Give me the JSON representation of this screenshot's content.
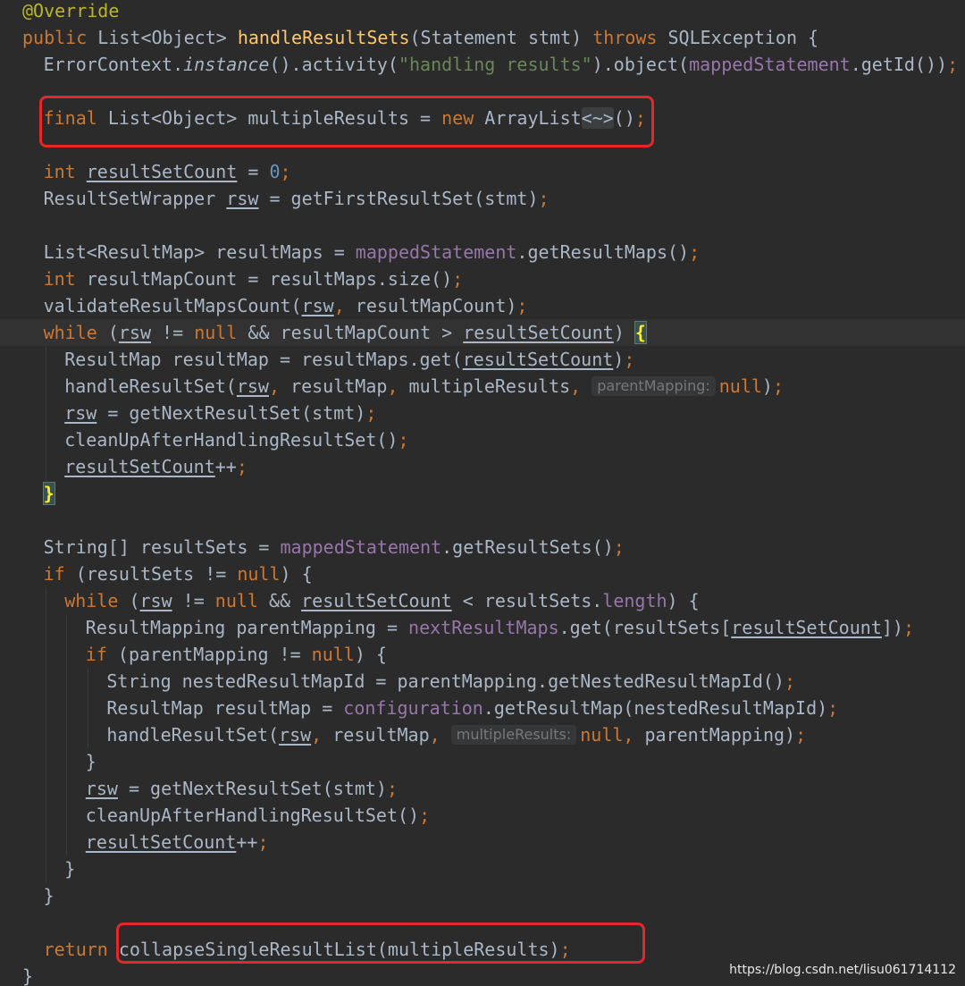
{
  "watermark": "https://blog.csdn.net/lisu061714112",
  "highlight_color": "#e5262b",
  "theme": {
    "background": "#2b2b2b",
    "keyword": "#cc7832",
    "annotation": "#bbb529",
    "method_declaration": "#ffc66d",
    "string": "#6a8759",
    "number": "#6897bb",
    "field": "#9876aa",
    "plain": "#a9b7c6"
  },
  "code": {
    "lines": [
      {
        "indent": 0,
        "tokens": [
          {
            "t": "@Override",
            "c": "ann"
          }
        ]
      },
      {
        "indent": 0,
        "tokens": [
          {
            "t": "public ",
            "c": "kw"
          },
          {
            "t": "List<Object> "
          },
          {
            "t": "handleResultSets",
            "c": "fn"
          },
          {
            "t": "(Statement stmt) "
          },
          {
            "t": "throws ",
            "c": "kw"
          },
          {
            "t": "SQLException {"
          }
        ]
      },
      {
        "indent": 1,
        "tokens": [
          {
            "t": "ErrorContext."
          },
          {
            "t": "instance",
            "c": "it"
          },
          {
            "t": "().activity("
          },
          {
            "t": "\"handling results\"",
            "c": "str"
          },
          {
            "t": ").object("
          },
          {
            "t": "mappedStatement",
            "c": "fld"
          },
          {
            "t": ".getId())"
          },
          {
            "t": ";",
            "c": "kw"
          }
        ]
      },
      {
        "indent": 0,
        "tokens": []
      },
      {
        "indent": 1,
        "tokens": [
          {
            "t": "final ",
            "c": "kw"
          },
          {
            "t": "List<Object> multipleResults = "
          },
          {
            "t": "new ",
            "c": "kw"
          },
          {
            "t": "ArrayList"
          },
          {
            "t": "<~>",
            "c": "fold"
          },
          {
            "t": "()"
          },
          {
            "t": ";",
            "c": "kw"
          }
        ]
      },
      {
        "indent": 0,
        "tokens": []
      },
      {
        "indent": 1,
        "tokens": [
          {
            "t": "int ",
            "c": "kw"
          },
          {
            "t": "resultSetCount",
            "c": "ul"
          },
          {
            "t": " = "
          },
          {
            "t": "0",
            "c": "num"
          },
          {
            "t": ";",
            "c": "kw"
          }
        ]
      },
      {
        "indent": 1,
        "tokens": [
          {
            "t": "ResultSetWrapper "
          },
          {
            "t": "rsw",
            "c": "ul"
          },
          {
            "t": " = getFirstResultSet(stmt)"
          },
          {
            "t": ";",
            "c": "kw"
          }
        ]
      },
      {
        "indent": 0,
        "tokens": []
      },
      {
        "indent": 1,
        "tokens": [
          {
            "t": "List<ResultMap> resultMaps = "
          },
          {
            "t": "mappedStatement",
            "c": "fld"
          },
          {
            "t": ".getResultMaps()"
          },
          {
            "t": ";",
            "c": "kw"
          }
        ]
      },
      {
        "indent": 1,
        "tokens": [
          {
            "t": "int ",
            "c": "kw"
          },
          {
            "t": "resultMapCount = resultMaps.size()"
          },
          {
            "t": ";",
            "c": "kw"
          }
        ]
      },
      {
        "indent": 1,
        "tokens": [
          {
            "t": "validateResultMapsCount("
          },
          {
            "t": "rsw",
            "c": "ul"
          },
          {
            "t": ", ",
            "c": "kw"
          },
          {
            "t": "resultMapCount)"
          },
          {
            "t": ";",
            "c": "kw"
          }
        ]
      },
      {
        "indent": 1,
        "current": true,
        "tokens": [
          {
            "t": "while ",
            "c": "kw"
          },
          {
            "t": "("
          },
          {
            "t": "rsw",
            "c": "ul"
          },
          {
            "t": " != "
          },
          {
            "t": "null ",
            "c": "kw"
          },
          {
            "t": "&& resultMapCount > "
          },
          {
            "t": "resultSetCount",
            "c": "ul"
          },
          {
            "t": ") "
          },
          {
            "t": "{",
            "c": "bracehl"
          }
        ]
      },
      {
        "indent": 2,
        "tokens": [
          {
            "t": "ResultMap resultMap = resultMaps.get("
          },
          {
            "t": "resultSetCount",
            "c": "ul"
          },
          {
            "t": ")"
          },
          {
            "t": ";",
            "c": "kw"
          }
        ]
      },
      {
        "indent": 2,
        "tokens": [
          {
            "t": "handleResultSet("
          },
          {
            "t": "rsw",
            "c": "ul"
          },
          {
            "t": ", ",
            "c": "kw"
          },
          {
            "t": "resultMap"
          },
          {
            "t": ", ",
            "c": "kw"
          },
          {
            "t": "multipleResults"
          },
          {
            "t": ", ",
            "c": "kw"
          },
          {
            "t": "parentMapping:",
            "c": "hint"
          },
          {
            "t": "null",
            "c": "kw"
          },
          {
            "t": ")"
          },
          {
            "t": ";",
            "c": "kw"
          }
        ]
      },
      {
        "indent": 2,
        "tokens": [
          {
            "t": "rsw",
            "c": "ul"
          },
          {
            "t": " = getNextResultSet(stmt)"
          },
          {
            "t": ";",
            "c": "kw"
          }
        ]
      },
      {
        "indent": 2,
        "tokens": [
          {
            "t": "cleanUpAfterHandlingResultSet()"
          },
          {
            "t": ";",
            "c": "kw"
          }
        ]
      },
      {
        "indent": 2,
        "tokens": [
          {
            "t": "resultSetCount",
            "c": "ul"
          },
          {
            "t": "++"
          },
          {
            "t": ";",
            "c": "kw"
          }
        ]
      },
      {
        "indent": 1,
        "tokens": [
          {
            "t": "}",
            "c": "bracehl"
          }
        ]
      },
      {
        "indent": 0,
        "tokens": []
      },
      {
        "indent": 1,
        "tokens": [
          {
            "t": "String[] resultSets = "
          },
          {
            "t": "mappedStatement",
            "c": "fld"
          },
          {
            "t": ".getResultSets()"
          },
          {
            "t": ";",
            "c": "kw"
          }
        ]
      },
      {
        "indent": 1,
        "tokens": [
          {
            "t": "if ",
            "c": "kw"
          },
          {
            "t": "(resultSets != "
          },
          {
            "t": "null",
            "c": "kw"
          },
          {
            "t": ") {"
          }
        ]
      },
      {
        "indent": 2,
        "tokens": [
          {
            "t": "while ",
            "c": "kw"
          },
          {
            "t": "("
          },
          {
            "t": "rsw",
            "c": "ul"
          },
          {
            "t": " != "
          },
          {
            "t": "null ",
            "c": "kw"
          },
          {
            "t": "&& "
          },
          {
            "t": "resultSetCount",
            "c": "ul"
          },
          {
            "t": " < resultSets."
          },
          {
            "t": "length",
            "c": "fld"
          },
          {
            "t": ") {"
          }
        ]
      },
      {
        "indent": 3,
        "tokens": [
          {
            "t": "ResultMapping parentMapping = "
          },
          {
            "t": "nextResultMaps",
            "c": "fld"
          },
          {
            "t": ".get(resultSets["
          },
          {
            "t": "resultSetCount",
            "c": "ul"
          },
          {
            "t": "])"
          },
          {
            "t": ";",
            "c": "kw"
          }
        ]
      },
      {
        "indent": 3,
        "tokens": [
          {
            "t": "if ",
            "c": "kw"
          },
          {
            "t": "(parentMapping != "
          },
          {
            "t": "null",
            "c": "kw"
          },
          {
            "t": ") {"
          }
        ]
      },
      {
        "indent": 4,
        "tokens": [
          {
            "t": "String nestedResultMapId = parentMapping.getNestedResultMapId()"
          },
          {
            "t": ";",
            "c": "kw"
          }
        ]
      },
      {
        "indent": 4,
        "tokens": [
          {
            "t": "ResultMap resultMap = "
          },
          {
            "t": "configuration",
            "c": "fld"
          },
          {
            "t": ".getResultMap(nestedResultMapId)"
          },
          {
            "t": ";",
            "c": "kw"
          }
        ]
      },
      {
        "indent": 4,
        "tokens": [
          {
            "t": "handleResultSet("
          },
          {
            "t": "rsw",
            "c": "ul"
          },
          {
            "t": ", ",
            "c": "kw"
          },
          {
            "t": "resultMap"
          },
          {
            "t": ", ",
            "c": "kw"
          },
          {
            "t": "multipleResults:",
            "c": "hint"
          },
          {
            "t": "null",
            "c": "kw"
          },
          {
            "t": ", ",
            "c": "kw"
          },
          {
            "t": "parentMapping)"
          },
          {
            "t": ";",
            "c": "kw"
          }
        ]
      },
      {
        "indent": 3,
        "tokens": [
          {
            "t": "}"
          }
        ]
      },
      {
        "indent": 3,
        "tokens": [
          {
            "t": "rsw",
            "c": "ul"
          },
          {
            "t": " = getNextResultSet(stmt)"
          },
          {
            "t": ";",
            "c": "kw"
          }
        ]
      },
      {
        "indent": 3,
        "tokens": [
          {
            "t": "cleanUpAfterHandlingResultSet()"
          },
          {
            "t": ";",
            "c": "kw"
          }
        ]
      },
      {
        "indent": 3,
        "tokens": [
          {
            "t": "resultSetCount",
            "c": "ul"
          },
          {
            "t": "++"
          },
          {
            "t": ";",
            "c": "kw"
          }
        ]
      },
      {
        "indent": 2,
        "tokens": [
          {
            "t": "}"
          }
        ]
      },
      {
        "indent": 1,
        "tokens": [
          {
            "t": "}"
          }
        ]
      },
      {
        "indent": 0,
        "tokens": []
      },
      {
        "indent": 1,
        "tokens": [
          {
            "t": "return ",
            "c": "kw"
          },
          {
            "t": "collapseSingleResultList(multipleResults)"
          },
          {
            "t": ";",
            "c": "kw"
          }
        ]
      },
      {
        "indent": 0,
        "tokens": [
          {
            "t": "}"
          }
        ]
      }
    ]
  }
}
